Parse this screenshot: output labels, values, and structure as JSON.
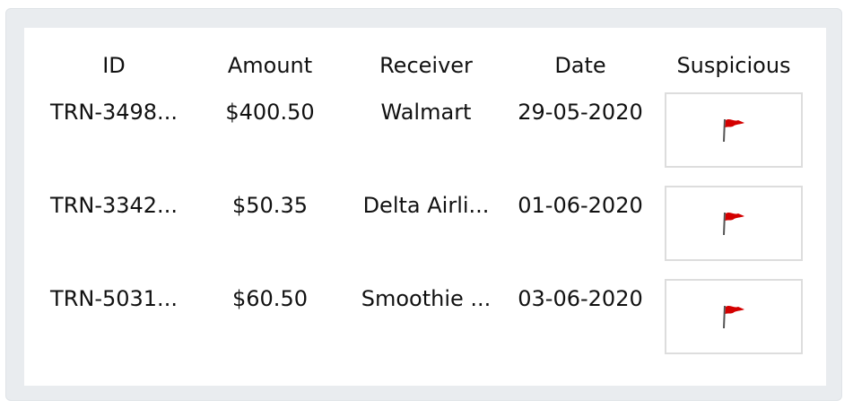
{
  "table": {
    "columns": [
      "ID",
      "Amount",
      "Receiver",
      "Date",
      "Suspicious"
    ],
    "rows": [
      {
        "id": "TRN-3498...",
        "amount": "$400.50",
        "receiver": "Walmart",
        "date": "29-05-2020",
        "suspicious_icon": "red-flag-icon"
      },
      {
        "id": "TRN-3342...",
        "amount": "$50.35",
        "receiver": "Delta Airli...",
        "date": "01-06-2020",
        "suspicious_icon": "red-flag-icon"
      },
      {
        "id": "TRN-5031...",
        "amount": "$60.50",
        "receiver": "Smoothie ...",
        "date": "03-06-2020",
        "suspicious_icon": "red-flag-icon"
      }
    ]
  },
  "colors": {
    "flag": "#d40000",
    "frame": "#e9ecef",
    "button_border": "#dddddd"
  }
}
